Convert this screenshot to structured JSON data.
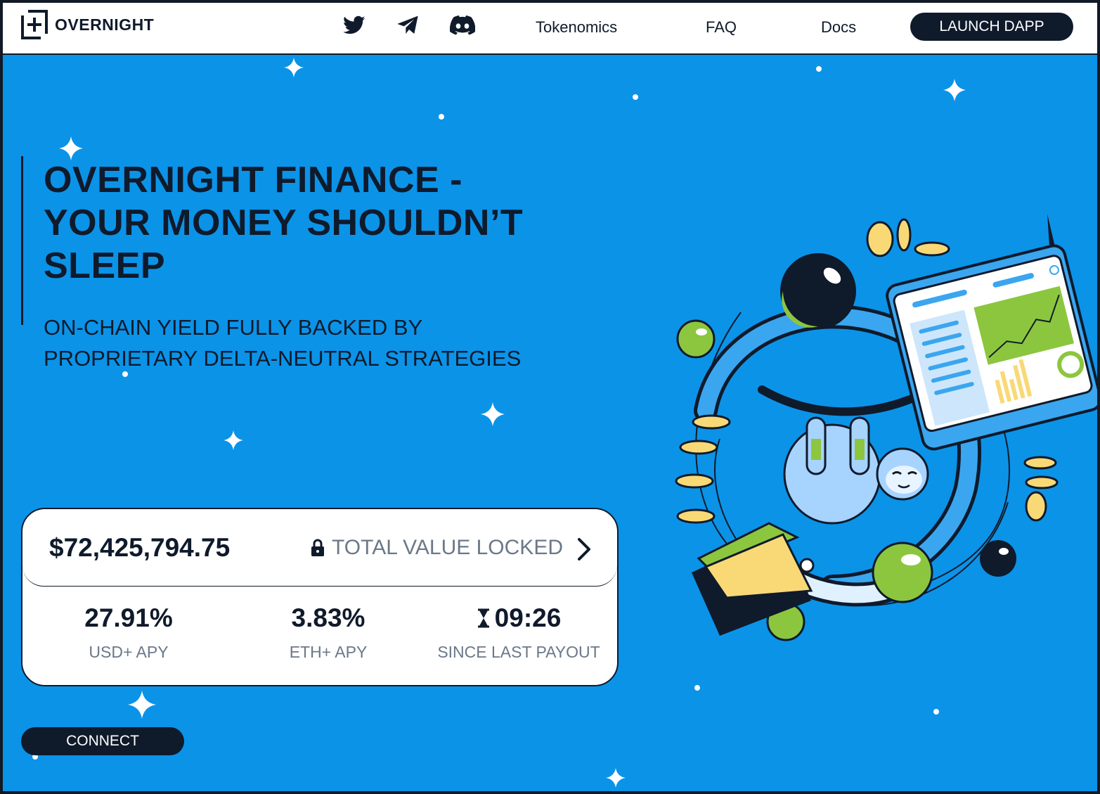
{
  "brand": {
    "name": "OVERNIGHT"
  },
  "header": {
    "social": [
      "twitter-icon",
      "telegram-icon",
      "discord-icon"
    ],
    "nav": [
      {
        "label": "Tokenomics"
      },
      {
        "label": "FAQ"
      },
      {
        "label": "Docs"
      }
    ],
    "launch_label": "LAUNCH DAPP"
  },
  "hero": {
    "title_line1": "OVERNIGHT FINANCE -",
    "title_line2": "YOUR MONEY SHOULDN’T",
    "title_line3": "SLEEP",
    "subtitle_line1": "ON-CHAIN YIELD FULLY BACKED BY",
    "subtitle_line2": "PROPRIETARY DELTA-NEUTRAL STRATEGIES"
  },
  "stats": {
    "tvl_value": "$72,425,794.75",
    "tvl_label": "TOTAL VALUE LOCKED",
    "items": [
      {
        "value": "27.91%",
        "label": "USD+ APY"
      },
      {
        "value": "3.83%",
        "label": "ETH+ APY"
      },
      {
        "value": "09:26",
        "label": "SINCE LAST PAYOUT"
      }
    ]
  },
  "connect_label": "CONNECT",
  "colors": {
    "background": "#0b93e8",
    "navy": "#0f1a2b",
    "lime": "#8cc63f",
    "yellow": "#f9d976"
  }
}
